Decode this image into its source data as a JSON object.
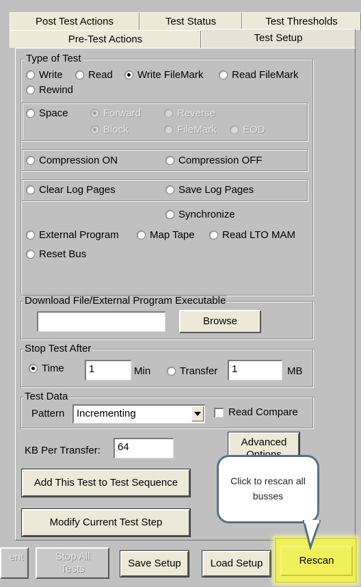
{
  "tabs": {
    "row1": [
      "Post Test Actions",
      "Test Status",
      "Test Thresholds"
    ],
    "row2": [
      "Pre-Test Actions",
      "Test Setup"
    ]
  },
  "type_of_test": {
    "legend": "Type of Test",
    "write": "Write",
    "read": "Read",
    "write_filemark": "Write FileMark",
    "read_filemark": "Read FileMark",
    "rewind": "Rewind",
    "space": "Space",
    "forward": "Forward",
    "reverse": "Reverse",
    "block": "Block",
    "filemark": "FileMark",
    "eod": "EOD",
    "compression_on": "Compression ON",
    "compression_off": "Compression OFF",
    "clear_log_pages": "Clear Log Pages",
    "save_log_pages": "Save Log Pages",
    "synchronize": "Synchronize",
    "external_program": "External Program",
    "map_tape": "Map Tape",
    "read_lto_mam": "Read LTO MAM",
    "reset_bus": "Reset Bus"
  },
  "download": {
    "legend": "Download File/External Program Executable",
    "value": "",
    "browse": "Browse"
  },
  "stop_after": {
    "legend": "Stop Test After",
    "time_label": "Time",
    "time_value": "1",
    "time_unit": "Min",
    "transfer_label": "Transfer",
    "transfer_value": "1",
    "transfer_unit": "MB"
  },
  "test_data": {
    "legend": "Test Data",
    "pattern_label": "Pattern",
    "pattern_value": "Incrementing",
    "read_compare": "Read Compare"
  },
  "kb_per_transfer": {
    "label": "KB Per Transfer:",
    "value": "64"
  },
  "buttons": {
    "advanced_options": "Advanced Options",
    "add_test": "Add This Test to Test Sequence",
    "modify_step": "Modify Current Test Step",
    "partial_left": "ent",
    "stop_all_tests": "Stop All Tests",
    "save_setup": "Save Setup",
    "load_setup": "Load Setup",
    "rescan": "Rescan"
  },
  "callout": {
    "text": "Click to rescan all busses"
  },
  "colors": {
    "background": "#c0c0c0",
    "highlight": "#f2f05a",
    "callout_border": "#5a6e8c"
  }
}
